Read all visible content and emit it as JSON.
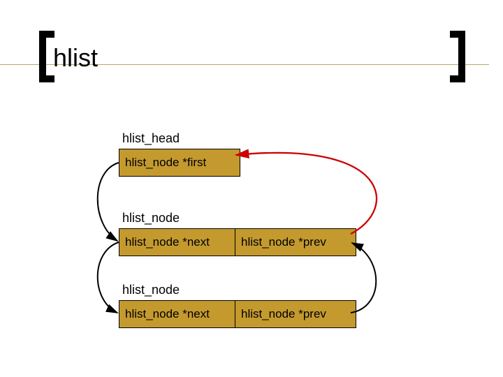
{
  "title": "hlist",
  "head_struct": {
    "name": "hlist_head",
    "field": "hlist_node *first"
  },
  "node1": {
    "name": "hlist_node",
    "next": "hlist_node *next",
    "prev": "hlist_node *prev"
  },
  "node2": {
    "name": "hlist_node",
    "next": "hlist_node *next",
    "prev": "hlist_node *prev"
  },
  "colors": {
    "box_fill": "#c49a2f",
    "bracket": "#000000",
    "rule": "#b7a86a",
    "arrow_red": "#cc0000",
    "arrow_black": "#000000"
  }
}
